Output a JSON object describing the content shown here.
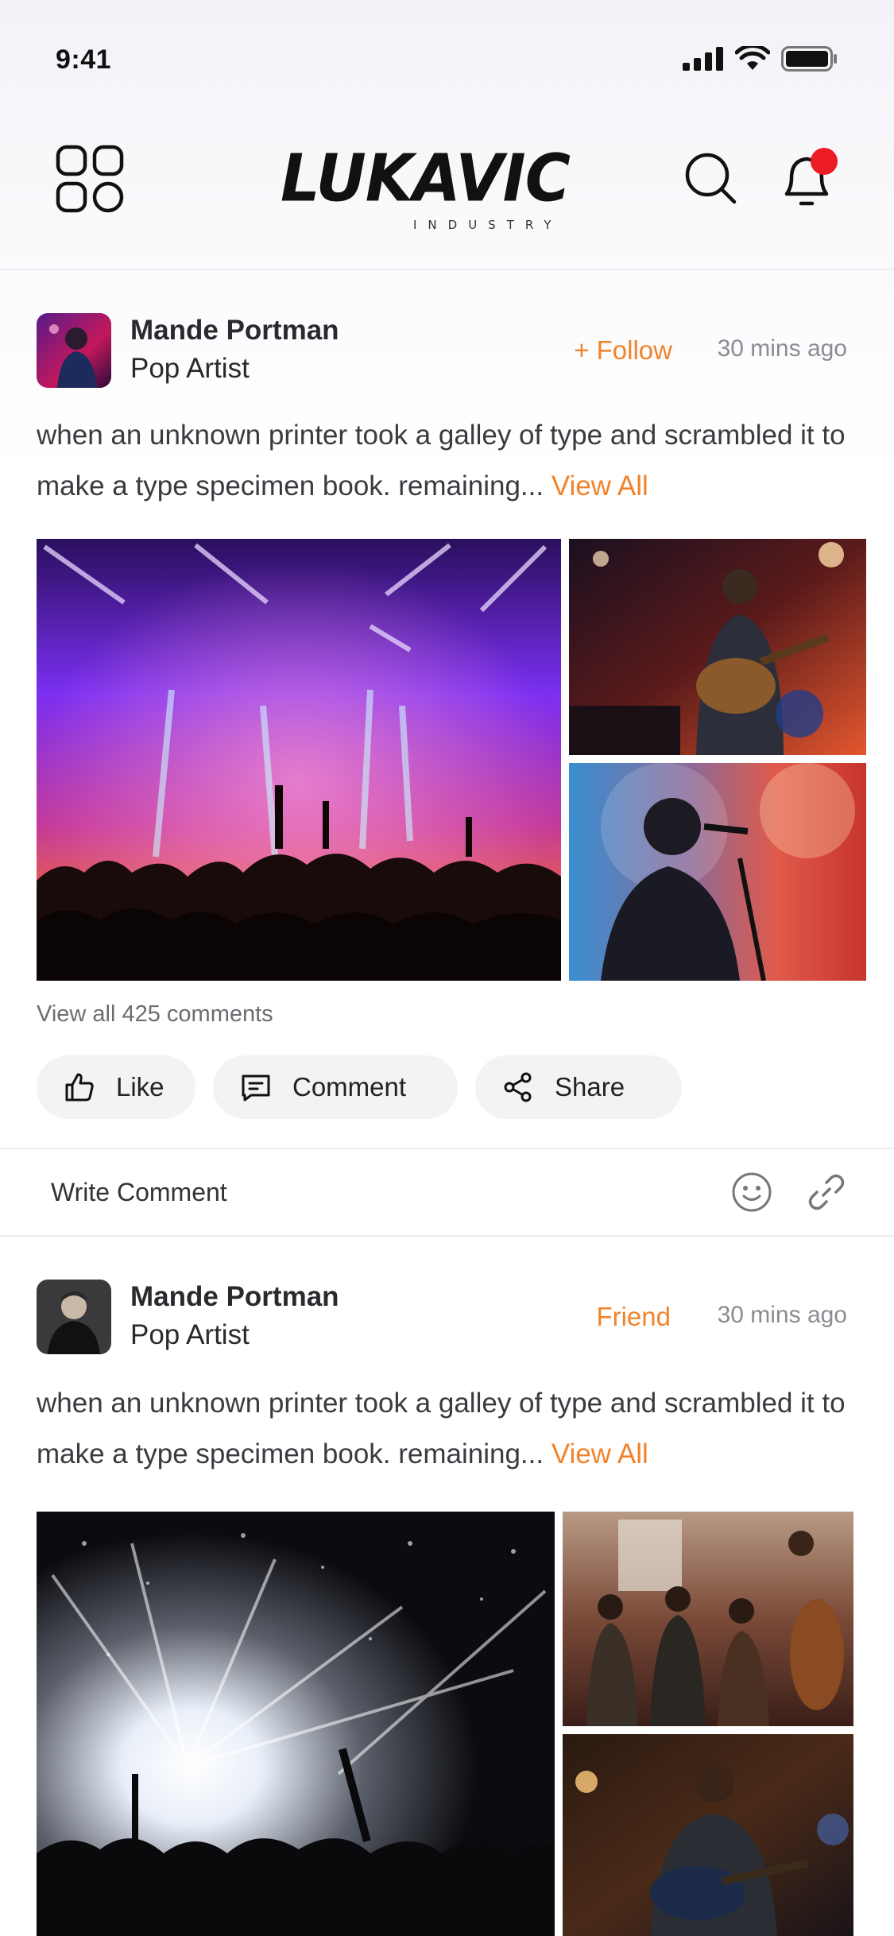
{
  "status_bar": {
    "time": "9:41"
  },
  "header": {
    "logo_text": "LUKAVIC",
    "logo_subtext": "INDUSTRY"
  },
  "posts": [
    {
      "author": {
        "name": "Mande Portman",
        "role": "Pop Artist"
      },
      "action_label": "+ Follow",
      "time": "30 mins ago",
      "text": "when an unknown printer took a galley of type and scrambled it to make a type specimen book. remaining...",
      "view_all": "View All",
      "comments_link": "View all 425 comments",
      "buttons": {
        "like": "Like",
        "comment": "Comment",
        "share": "Share"
      },
      "write_comment": "Write Comment"
    },
    {
      "author": {
        "name": "Mande Portman",
        "role": "Pop Artist"
      },
      "action_label": "Friend",
      "time": "30 mins ago",
      "text": "when an unknown printer took a galley of type and scrambled it to make a type specimen book. remaining...",
      "view_all": "View All"
    }
  ],
  "colors": {
    "accent": "#f0832b",
    "notification_dot": "#ec1c24",
    "text_primary": "#2a2a2e",
    "text_muted": "#8b8b92"
  },
  "icons": {
    "menu": "grid-icon",
    "search": "search-icon",
    "notifications": "bell-icon",
    "like": "thumbs-up-icon",
    "comment": "comment-icon",
    "share": "share-icon",
    "emoji": "smiley-icon",
    "attach": "link-icon"
  }
}
